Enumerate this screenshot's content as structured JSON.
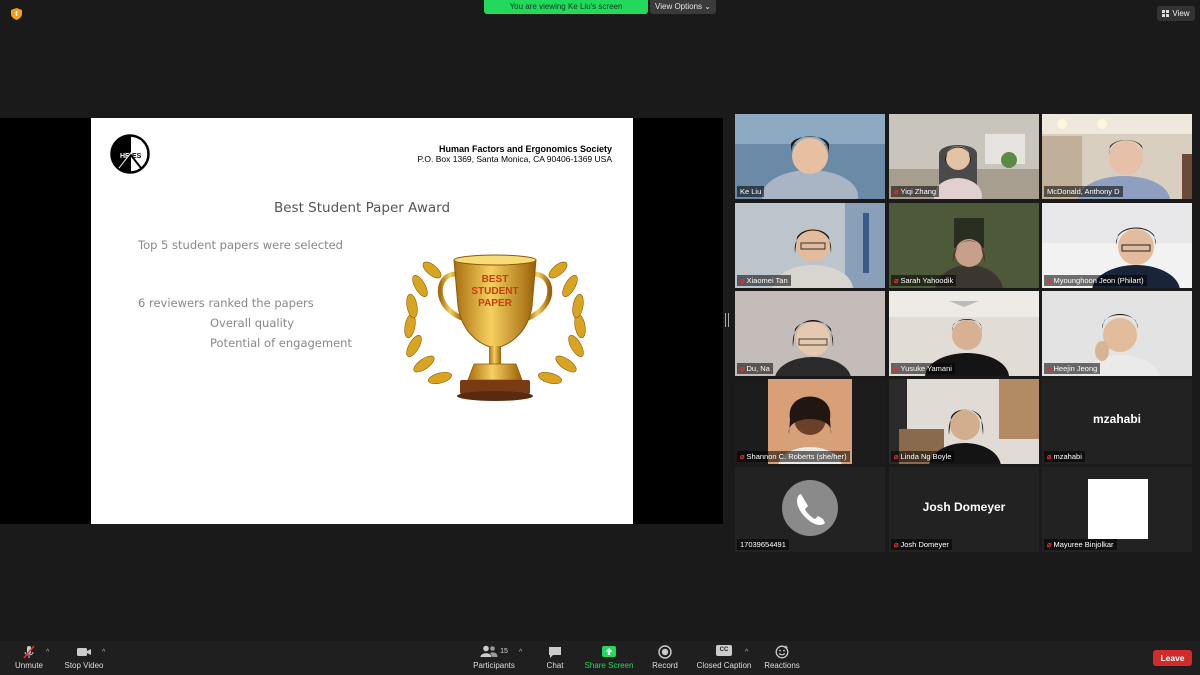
{
  "top": {
    "viewing_text": "You are viewing Ke Liu's screen",
    "view_options": "View Options ⌄",
    "view_button": "View"
  },
  "slide": {
    "society_name": "Human Factors and Ergonomics Society",
    "society_address": "P.O. Box 1369, Santa Monica, CA 90406-1369 USA",
    "logo_text_left": "HF",
    "logo_text_right": "ES",
    "title": "Best Student Paper Award",
    "line1": "Top 5 student papers were selected",
    "line2": "6 reviewers ranked the papers",
    "line3": "Overall quality",
    "line4": "Potential of engagement",
    "trophy_text": [
      "BEST",
      "STUDENT",
      "PAPER"
    ]
  },
  "participants": [
    {
      "name": "Ke Liu",
      "muted": false
    },
    {
      "name": "Yiqi Zhang",
      "muted": true
    },
    {
      "name": "McDonald, Anthony D",
      "muted": false,
      "active": true
    },
    {
      "name": "Xiaomei Tan",
      "muted": true
    },
    {
      "name": "Sarah Yahoodik",
      "muted": true
    },
    {
      "name": "Myounghoon Jeon (Philart)",
      "muted": true
    },
    {
      "name": "Du, Na",
      "muted": true
    },
    {
      "name": "Yusuke Yamani",
      "muted": true
    },
    {
      "name": "Heejin Jeong",
      "muted": true
    },
    {
      "name": "Shannon C. Roberts  (she/her)",
      "muted": true
    },
    {
      "name": "Linda Ng Boyle",
      "muted": true
    },
    {
      "name": "mzahabi",
      "muted": true,
      "big": "mzahabi"
    },
    {
      "name": "17039654491",
      "muted": false
    },
    {
      "name": "Josh Domeyer",
      "muted": true,
      "big": "Josh Domeyer"
    },
    {
      "name": "Mayuree Binjolkar",
      "muted": true
    }
  ],
  "toolbar": {
    "unmute": "Unmute",
    "stop_video": "Stop Video",
    "participants": "Participants",
    "participants_count": "15",
    "chat": "Chat",
    "share_screen": "Share Screen",
    "record": "Record",
    "closed_caption": "Closed Caption",
    "cc_badge": "CC",
    "reactions": "Reactions",
    "leave": "Leave"
  },
  "colors": {
    "accent_green": "#23d95c",
    "leave_red": "#d22b2b",
    "active_speaker": "#d8e05a",
    "trophy_gold": "#d9a520"
  }
}
